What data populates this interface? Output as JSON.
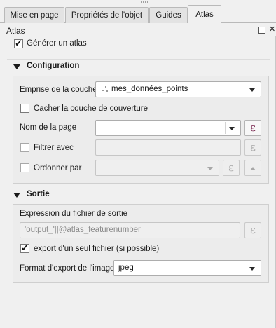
{
  "tabs": [
    {
      "label": "Mise en page"
    },
    {
      "label": "Propriétés de l'objet"
    },
    {
      "label": "Guides"
    },
    {
      "label": "Atlas"
    }
  ],
  "panel": {
    "title": "Atlas",
    "generate": {
      "label": "Générer un atlas",
      "checked": true
    }
  },
  "configuration": {
    "title": "Configuration",
    "coverage_layer": {
      "label": "Emprise de la couche",
      "value": "mes_données_points",
      "icon": "point-layer-icon"
    },
    "hide_coverage": {
      "label": "Cacher la couche de couverture",
      "checked": false
    },
    "page_name": {
      "label": "Nom de la page",
      "value": ""
    },
    "filter": {
      "label": "Filtrer avec",
      "checked": false,
      "value": ""
    },
    "sort": {
      "label": "Ordonner par",
      "checked": false,
      "value": ""
    },
    "epsilon_symbol": "ε"
  },
  "output": {
    "title": "Sortie",
    "filename_expression": {
      "label": "Expression du fichier de sortie",
      "value": "'output_'||@atlas_featurenumber"
    },
    "single_file": {
      "label": "export d'un seul fichier (si possible)",
      "checked": true
    },
    "export_format": {
      "label": "Format d'export de l'image",
      "value": "jpeg"
    }
  },
  "colors": {
    "epsilon": "#7b2a52",
    "panel_bg": "#f0f0f0"
  }
}
